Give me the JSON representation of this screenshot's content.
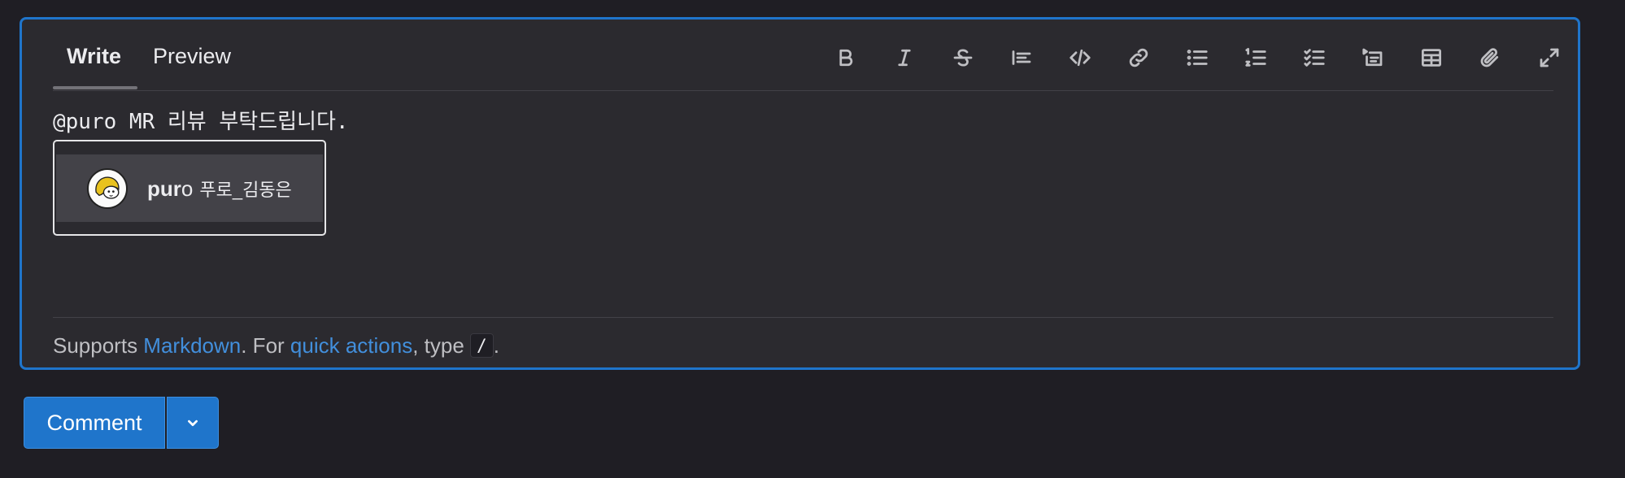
{
  "tabs": {
    "write": "Write",
    "preview": "Preview",
    "active": "Write"
  },
  "toolbar": {
    "icons": [
      "bold-icon",
      "italic-icon",
      "strikethrough-icon",
      "quote-icon",
      "code-icon",
      "link-icon",
      "bullet-list-icon",
      "numbered-list-icon",
      "task-list-icon",
      "collapsible-section-icon",
      "table-icon",
      "attach-file-icon",
      "fullscreen-icon"
    ]
  },
  "editor": {
    "text": "@puro MR 리뷰 부탁드립니다."
  },
  "autocomplete": {
    "items": [
      {
        "username_match": "pur",
        "username_rest": "o",
        "display_name": "푸로_김동은",
        "avatar": "avatar-image"
      }
    ]
  },
  "footer": {
    "supports": "Supports ",
    "markdown_link": "Markdown",
    "for_text": ". For ",
    "quick_actions_link": "quick actions",
    "type_text": ", type ",
    "slash": "/",
    "period": "."
  },
  "actions": {
    "comment": "Comment",
    "dropdown_icon": "chevron-down-icon"
  },
  "colors": {
    "accent": "#1f75cb",
    "link": "#428fdc",
    "background": "#1f1e24",
    "panel": "#2b2a2f"
  }
}
